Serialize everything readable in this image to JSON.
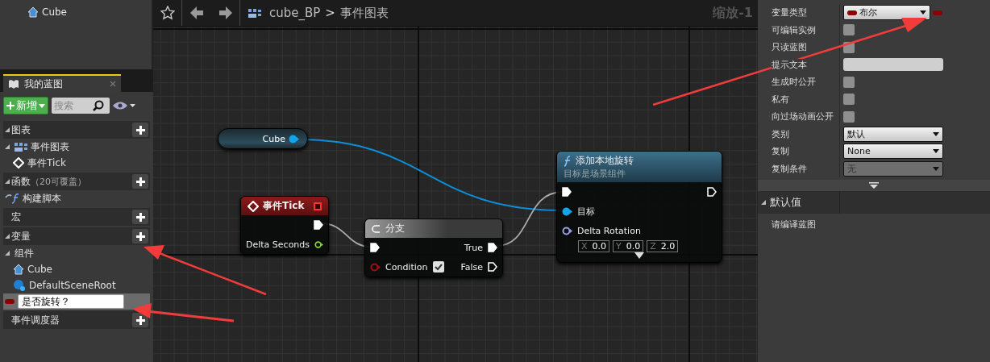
{
  "components_tree": {
    "items": [
      {
        "label": "Cube",
        "kind": "mesh"
      }
    ]
  },
  "my_blueprint": {
    "tab": {
      "label": "我的蓝图",
      "selected": true
    },
    "add_button": "新增",
    "search": {
      "placeholder": "搜索"
    },
    "sections": [
      {
        "title": "图表",
        "expanded": true,
        "add": true,
        "items": [
          {
            "kind": "graph",
            "label": "事件图表",
            "expanded": true,
            "children": [
              {
                "kind": "event",
                "label": "事件Tick"
              }
            ]
          }
        ]
      },
      {
        "title": "函数",
        "note": "（20可覆盖）",
        "expanded": true,
        "add": true,
        "items": [
          {
            "kind": "function",
            "label": "构建脚本"
          }
        ]
      },
      {
        "title": "宏",
        "add": true
      },
      {
        "title": "变量",
        "expanded": true,
        "add": true,
        "items": [
          {
            "kind": "category",
            "label": "组件",
            "expanded": true,
            "children": [
              {
                "kind": "mesh",
                "label": "Cube"
              },
              {
                "kind": "scene",
                "label": "DefaultSceneRoot"
              }
            ]
          },
          {
            "kind": "variable",
            "label": "是否旋转？",
            "selected": true,
            "editing": true
          }
        ]
      },
      {
        "title": "事件调度器",
        "add": true
      }
    ]
  },
  "graph": {
    "breadcrumb": [
      "cube_BP",
      "事件图表"
    ],
    "separator": ">",
    "zoom": "缩放-1",
    "nodes": [
      {
        "kind": "getter",
        "title": "Cube",
        "outputs": [
          {
            "kind": "object",
            "connected": true
          }
        ]
      },
      {
        "kind": "event",
        "title": "事件Tick",
        "outputs": [
          {
            "kind": "exec",
            "connected": true
          },
          {
            "kind": "float",
            "label": "Delta Seconds",
            "connected": false
          }
        ]
      },
      {
        "kind": "branch",
        "title": "分支",
        "inputs": [
          {
            "kind": "exec",
            "connected": true
          },
          {
            "kind": "bool",
            "label": "Condition",
            "connected": false,
            "checked": true
          }
        ],
        "outputs": [
          {
            "kind": "exec",
            "label": "True",
            "connected": true
          },
          {
            "kind": "exec",
            "label": "False",
            "connected": false
          }
        ]
      },
      {
        "kind": "function",
        "title": "添加本地旋转",
        "subtitle": "目标是场景组件",
        "inputs": [
          {
            "kind": "exec",
            "connected": true
          },
          {
            "kind": "object",
            "label": "目标",
            "connected": true
          },
          {
            "kind": "rotator",
            "label": "Delta Rotation",
            "connected": false,
            "fields": [
              {
                "axis": "X",
                "value": "0.0"
              },
              {
                "axis": "Y",
                "value": "0.0"
              },
              {
                "axis": "Z",
                "value": "2.0"
              }
            ]
          }
        ],
        "outputs": [
          {
            "kind": "exec",
            "connected": false
          }
        ]
      }
    ]
  },
  "details": {
    "rows": [
      {
        "label": "变量类型",
        "kind": "type",
        "value": "布尔"
      },
      {
        "label": "可编辑实例",
        "kind": "checkbox",
        "checked": false
      },
      {
        "label": "只读蓝图",
        "kind": "checkbox",
        "checked": false
      },
      {
        "label": "提示文本",
        "kind": "text"
      },
      {
        "label": "生成时公开",
        "kind": "checkbox",
        "checked": false
      },
      {
        "label": "私有",
        "kind": "checkbox",
        "checked": false
      },
      {
        "label": "向过场动画公开",
        "kind": "checkbox",
        "checked": false
      },
      {
        "label": "类别",
        "kind": "combo",
        "value": "默认"
      },
      {
        "label": "复制",
        "kind": "dropdown",
        "value": "None",
        "disabled": false
      },
      {
        "label": "复制条件",
        "kind": "dropdown",
        "value": "无",
        "disabled": true
      }
    ],
    "default_section": {
      "title": "默认值",
      "expanded": true,
      "message": "请编译蓝图"
    }
  }
}
